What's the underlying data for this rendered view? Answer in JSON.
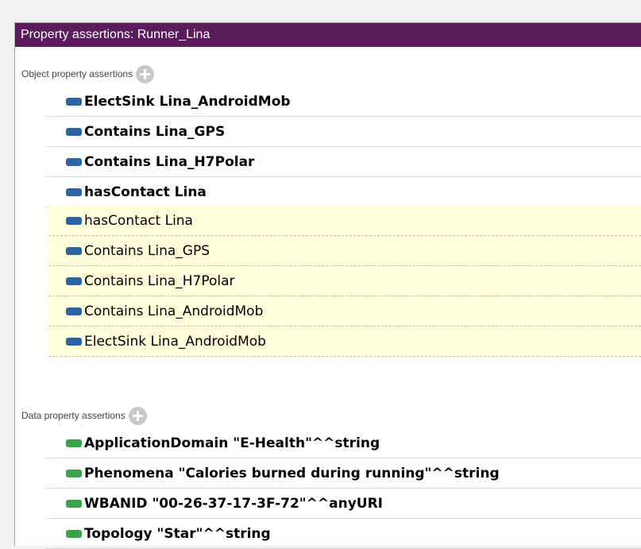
{
  "panel": {
    "title": "Property assertions: Runner_Lina"
  },
  "object_section": {
    "label": "Object property assertions",
    "add_icon": "plus-circle-icon",
    "asserted": [
      "ElectSink  Lina_AndroidMob",
      "Contains  Lina_GPS",
      "Contains  Lina_H7Polar",
      "hasContact  Lina"
    ],
    "inferred": [
      "hasContact  Lina",
      "Contains  Lina_GPS",
      "Contains  Lina_H7Polar",
      "Contains  Lina_AndroidMob",
      "ElectSink  Lina_AndroidMob"
    ]
  },
  "data_section": {
    "label": "Data property assertions",
    "add_icon": "plus-circle-icon",
    "asserted": [
      "ApplicationDomain  \"E-Health\"^^string",
      "Phenomena  \"Calories burned during running\"^^string",
      "WBANID  \"00-26-37-17-3F-72\"^^anyURI",
      "Topology  \"Star\"^^string"
    ]
  },
  "colors": {
    "title_bar": "#5b1b5c",
    "object_property_icon": "#2e63a4",
    "data_property_icon": "#3aa24a",
    "inferred_background": "#ffffdc"
  }
}
